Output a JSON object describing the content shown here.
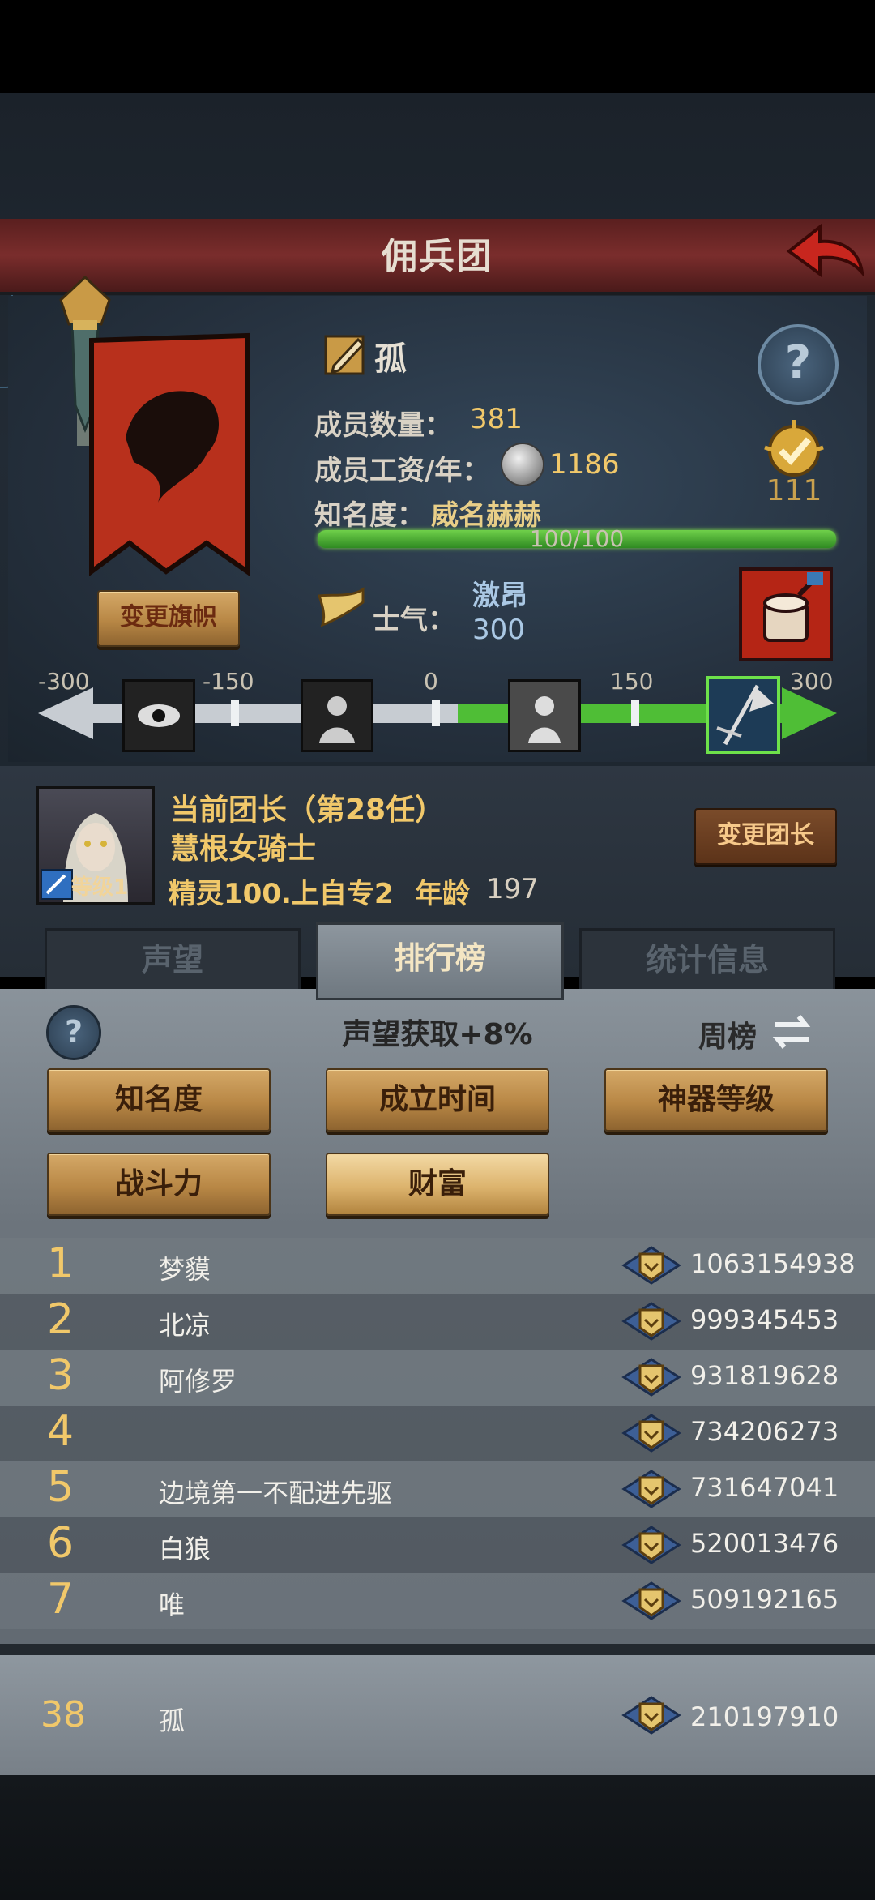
{
  "header": {
    "title": "佣兵团"
  },
  "guild": {
    "name": "孤",
    "members_label": "成员数量：",
    "members_value": "381",
    "wage_label": "成员工资/年：",
    "wage_value": "1186",
    "badge_value": "111",
    "fame_label": "知名度：",
    "fame_value": "威名赫赫",
    "fame_progress": "100/100",
    "fame_fraction": 1.0,
    "morale_label": "士气：",
    "morale_word": "激昂",
    "morale_value": "300",
    "change_flag_label": "变更旗帜"
  },
  "morale_scale": {
    "ticks": [
      "-300",
      "-150",
      "0",
      "150",
      "300"
    ],
    "icons": [
      "eye-icon",
      "despair-icon",
      "calm-icon",
      "rally-icon"
    ]
  },
  "leader": {
    "title": "当前团长（第28任）",
    "name": "慧根女骑士",
    "race": "精灵100.上自专2",
    "age_label": "年龄",
    "age": "197",
    "level": "等级1",
    "change_label": "变更团长"
  },
  "tabs": {
    "prestige": "声望",
    "ranking": "排行榜",
    "stats": "统计信息"
  },
  "ranking": {
    "prestige_gain": "声望获取+8%",
    "period": "周榜",
    "categories": [
      "知名度",
      "成立时间",
      "神器等级",
      "战斗力",
      "财富"
    ],
    "active_category": "财富",
    "rows": [
      {
        "rank": "1",
        "name": "梦貘",
        "value": "1063154938"
      },
      {
        "rank": "2",
        "name": "北凉",
        "value": "999345453"
      },
      {
        "rank": "3",
        "name": "阿修罗",
        "value": "931819628"
      },
      {
        "rank": "4",
        "name": "",
        "value": "734206273"
      },
      {
        "rank": "5",
        "name": "边境第一不配进先驱",
        "value": "731647041"
      },
      {
        "rank": "6",
        "name": "白狼",
        "value": "520013476"
      },
      {
        "rank": "7",
        "name": "唯",
        "value": "509192165"
      }
    ],
    "self": {
      "rank": "38",
      "name": "孤",
      "value": "210197910"
    }
  },
  "colors": {
    "gold": "#f1c86a",
    "header_red": "#7a2d2c",
    "fame_green": "#3f9a2f",
    "active_gold": "#dcb36d"
  }
}
